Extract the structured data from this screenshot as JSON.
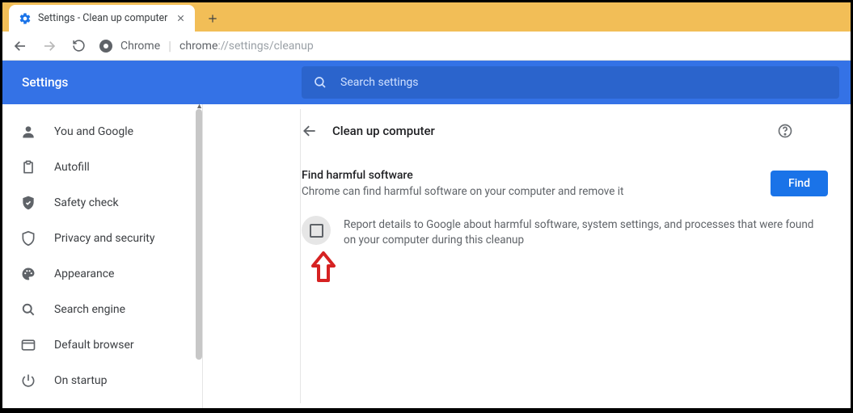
{
  "browser": {
    "tab_title": "Settings - Clean up computer",
    "address_label": "Chrome",
    "address_path_prefix": "chrome",
    "address_path_rest": "://settings/cleanup"
  },
  "header": {
    "title": "Settings",
    "search_placeholder": "Search settings"
  },
  "sidebar": {
    "items": [
      {
        "icon": "person",
        "label": "You and Google"
      },
      {
        "icon": "clipboard",
        "label": "Autofill"
      },
      {
        "icon": "shield-check",
        "label": "Safety check"
      },
      {
        "icon": "shield",
        "label": "Privacy and security"
      },
      {
        "icon": "palette",
        "label": "Appearance"
      },
      {
        "icon": "search",
        "label": "Search engine"
      },
      {
        "icon": "browser",
        "label": "Default browser"
      },
      {
        "icon": "power",
        "label": "On startup"
      }
    ]
  },
  "main": {
    "back_label": "Back",
    "page_title": "Clean up computer",
    "section_title": "Find harmful software",
    "section_subtitle": "Chrome can find harmful software on your computer and remove it",
    "find_button": "Find",
    "report_text": "Report details to Google about harmful software, system settings, and processes that were found on your computer during this cleanup"
  }
}
